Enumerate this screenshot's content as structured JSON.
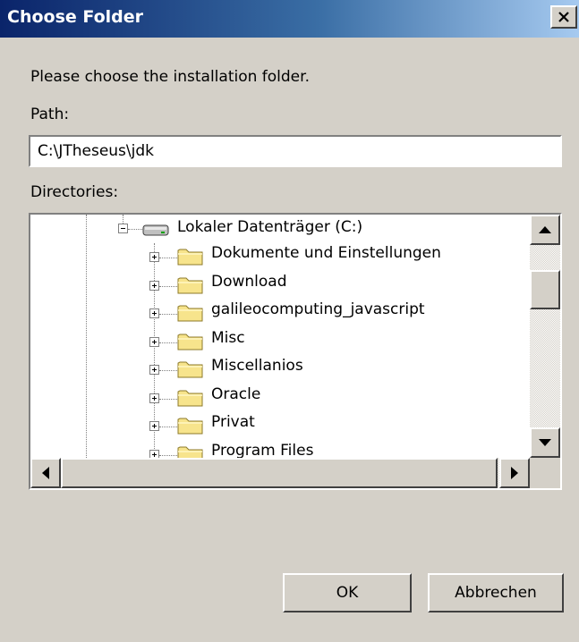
{
  "window": {
    "title": "Choose Folder",
    "close_glyph": "✕"
  },
  "prompt": "Please choose the installation folder.",
  "path": {
    "label": "Path:",
    "value": "C:\\JTheseus\\jdk"
  },
  "directories": {
    "label": "Directories:",
    "drive": "Lokaler Datenträger (C:)",
    "folders": [
      "Dokumente und Einstellungen",
      "Download",
      "galileocomputing_javascript",
      "Misc",
      "Miscellanios",
      "Oracle",
      "Privat",
      "Program Files"
    ]
  },
  "buttons": {
    "ok": "OK",
    "cancel": "Abbrechen"
  },
  "colors": {
    "title_start": "#0a246a",
    "title_end": "#a6caf0",
    "face": "#d4d0c8",
    "folder": "#f7e48c"
  },
  "icons": [
    "close-icon",
    "drive-icon",
    "folder-icon",
    "scroll-up-arrow-icon",
    "scroll-down-arrow-icon",
    "scroll-left-arrow-icon",
    "scroll-right-arrow-icon"
  ]
}
